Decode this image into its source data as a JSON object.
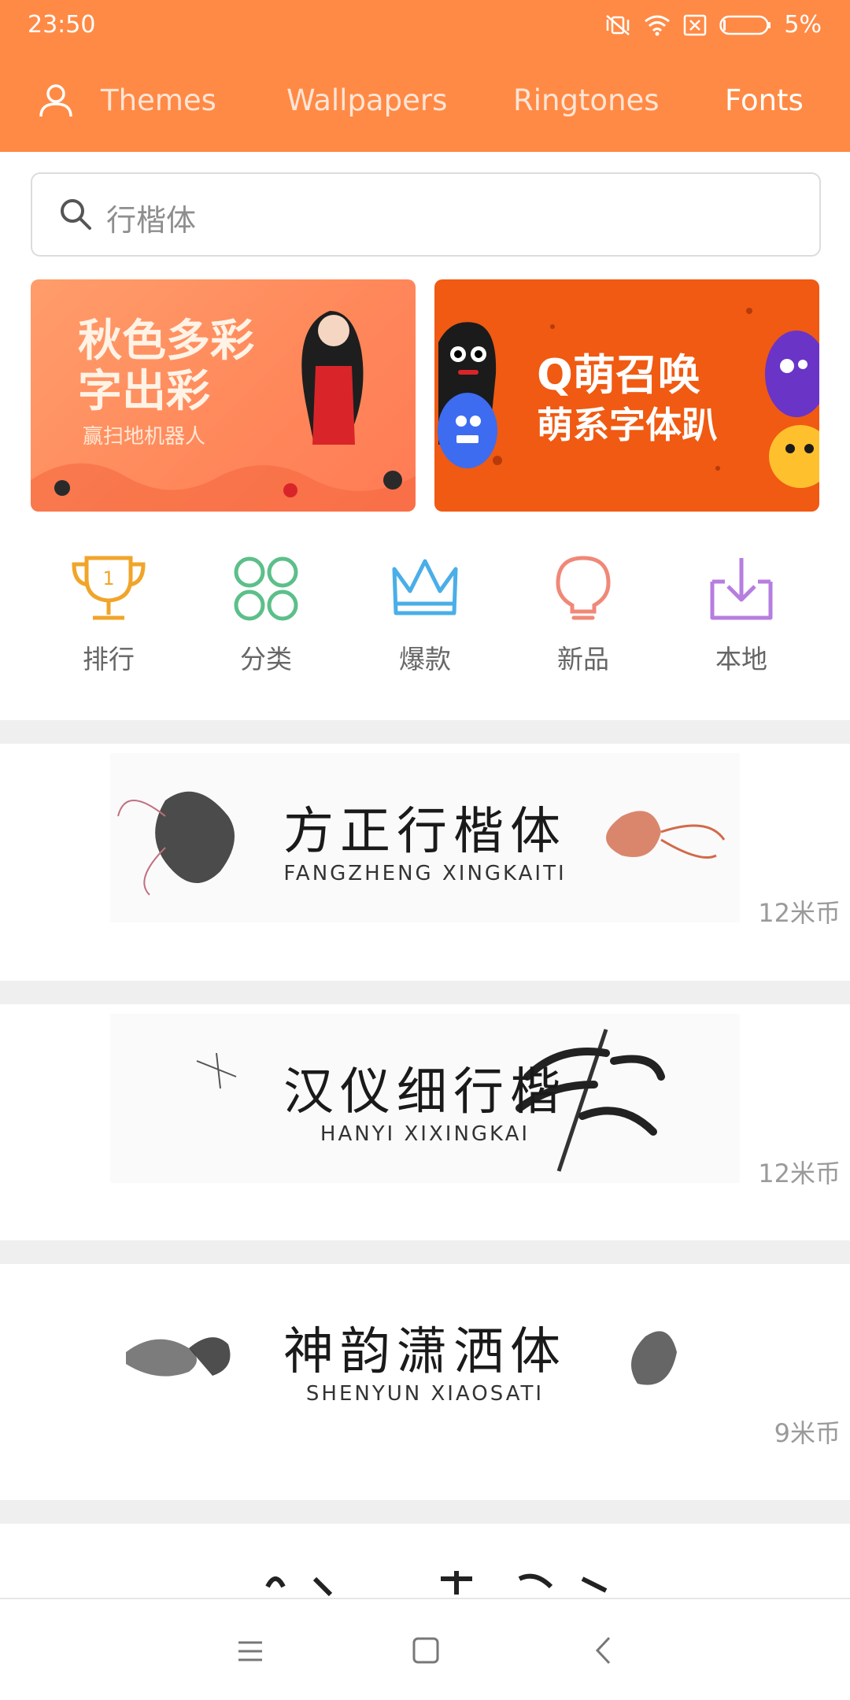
{
  "status_bar": {
    "time": "23:50",
    "battery_text": "5%",
    "icons": [
      "vibrate-mute-icon",
      "wifi-icon",
      "sim-off-icon",
      "battery-icon"
    ]
  },
  "tabs": [
    {
      "label": "Themes",
      "active": false
    },
    {
      "label": "Wallpapers",
      "active": false
    },
    {
      "label": "Ringtones",
      "active": false
    },
    {
      "label": "Fonts",
      "active": true
    }
  ],
  "search": {
    "placeholder": "行楷体"
  },
  "banners": [
    {
      "line1": "秋色多彩",
      "line2": "字出彩",
      "sub": "赢扫地机器人"
    },
    {
      "line1": "Q萌召唤",
      "line2": "萌系字体趴"
    }
  ],
  "categories": [
    {
      "label": "排行",
      "icon": "trophy-icon",
      "color": "#f0a52a"
    },
    {
      "label": "分类",
      "icon": "grid-circles-icon",
      "color": "#5cbf8a"
    },
    {
      "label": "爆款",
      "icon": "crown-icon",
      "color": "#4aaee8"
    },
    {
      "label": "新品",
      "icon": "lightbulb-icon",
      "color": "#f08878"
    },
    {
      "label": "本地",
      "icon": "download-icon",
      "color": "#b67ee0"
    }
  ],
  "fonts": [
    {
      "name": "方正行楷体",
      "en": "FANGZHENG XINGKAITI",
      "price": "12米币"
    },
    {
      "name": "汉仪细行楷",
      "en": "HANYI XIXINGKAI",
      "price": "12米币"
    },
    {
      "name": "神韵潇洒体",
      "en": "SHENYUN XIAOSATI",
      "price": "9米币"
    }
  ],
  "colors": {
    "header": "#ff8a45",
    "separator": "#efefef"
  }
}
